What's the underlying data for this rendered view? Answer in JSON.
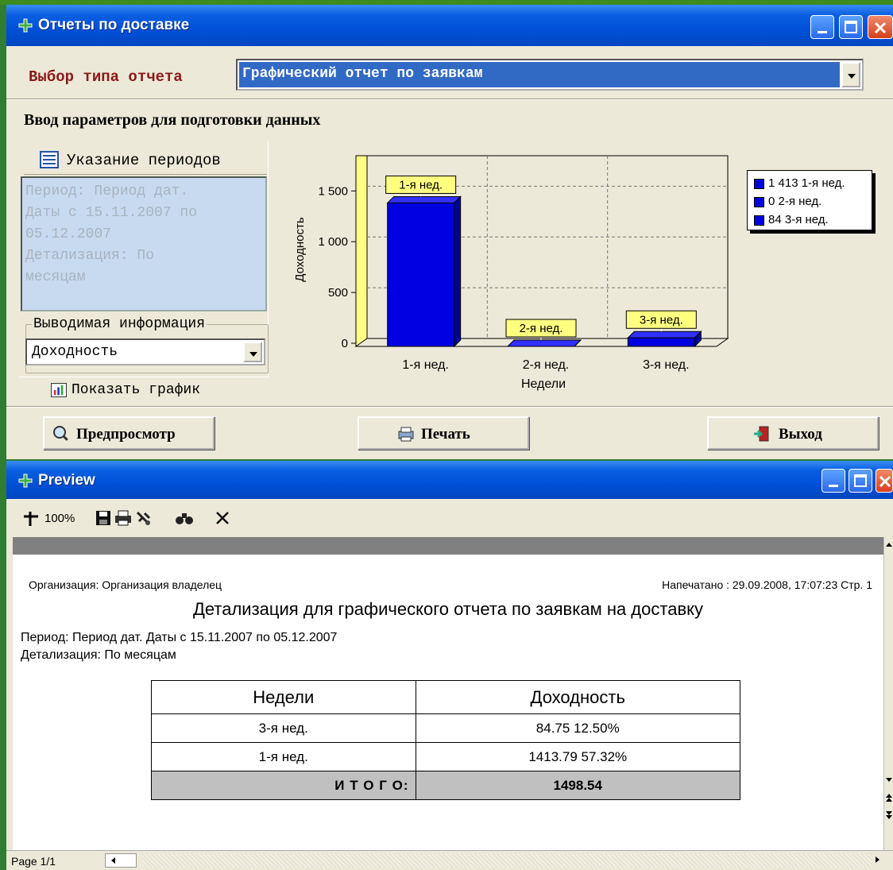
{
  "window1": {
    "title": "Отчеты по доставке",
    "report_type_label": "Выбор типа отчета",
    "report_type_value": "Графический отчет по заявкам",
    "params_title": "Ввод параметров для подготовки данных",
    "periods_button": "Указание периодов",
    "period_text": [
      "Период: Период дат.",
      "Даты с 15.11.2007 по",
      "05.12.2007",
      "Детализация: По",
      "месяцам"
    ],
    "output_group_label": "Выводимая информация",
    "output_value": "Доходность",
    "show_chart_tab": "Показать график",
    "buttons": {
      "preview": "Предпросмотр",
      "print": "Печать",
      "exit": "Выход"
    }
  },
  "chart_data": {
    "type": "bar",
    "categories": [
      "1-я нед.",
      "2-я нед.",
      "3-я нед."
    ],
    "values": [
      1413,
      0,
      84
    ],
    "xlabel": "Недели",
    "ylabel": "Доходность",
    "yticks": [
      "0",
      "500",
      "1 000",
      "1 500"
    ],
    "ylim": [
      0,
      1800
    ],
    "bar_labels": [
      "1-я нед.",
      "2-я нед.",
      "3-я нед."
    ],
    "legend": [
      "1 413 1-я нед.",
      "0 2-я нед.",
      "84 3-я нед."
    ],
    "legend_position": "right",
    "grid": true,
    "bar_color": "#0000e0",
    "label_bg": "#ffff80"
  },
  "window2": {
    "title": "Preview",
    "zoom": "100%",
    "report": {
      "organization": "Организация: Организация владелец",
      "printed": "Напечатано : 29.09.2008, 17:07:23 Стр. 1",
      "title": "Детализация для графического отчета по заявкам на доставку",
      "period": "Период: Период дат.  Даты с 15.11.2007 по 05.12.2007",
      "detail": "Детализация: По месяцам",
      "headers": [
        "Недели",
        "Доходность"
      ],
      "rows": [
        [
          "3-я нед.",
          "84.75  12.50%"
        ],
        [
          "1-я нед.",
          "1413.79  57.32%"
        ]
      ],
      "total_label": "И Т О Г О:",
      "total_value": "1498.54"
    },
    "status": "Page 1/1"
  }
}
